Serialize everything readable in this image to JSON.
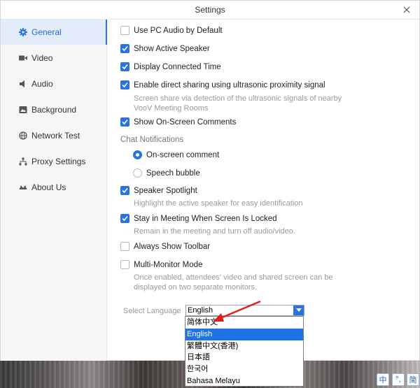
{
  "window": {
    "title": "Settings"
  },
  "sidebar": {
    "items": [
      {
        "label": "General",
        "icon": "gear-icon",
        "active": true
      },
      {
        "label": "Video",
        "icon": "video-camera-icon"
      },
      {
        "label": "Audio",
        "icon": "speaker-icon"
      },
      {
        "label": "Background",
        "icon": "image-icon"
      },
      {
        "label": "Network Test",
        "icon": "globe-icon"
      },
      {
        "label": "Proxy Settings",
        "icon": "network-icon"
      },
      {
        "label": "About Us",
        "icon": "infinity-icon"
      }
    ]
  },
  "general": {
    "use_pc_audio": {
      "label": "Use PC Audio by Default",
      "checked": false
    },
    "show_active_speaker": {
      "label": "Show Active Speaker",
      "checked": true
    },
    "display_connected_time": {
      "label": "Display Connected Time",
      "checked": true
    },
    "direct_sharing": {
      "label": "Enable direct sharing using ultrasonic proximity signal",
      "checked": true,
      "desc_line1": "Screen share via detection of the ultrasonic signals of nearby",
      "desc_line2": "VooV Meeting Rooms"
    },
    "on_screen_comments": {
      "label": "Show On-Screen Comments",
      "checked": true
    },
    "chat_notifications": {
      "label": "Chat Notifications",
      "options": [
        {
          "label": "On-screen comment",
          "selected": true
        },
        {
          "label": "Speech bubble",
          "selected": false
        }
      ]
    },
    "speaker_spotlight": {
      "label": "Speaker Spotlight",
      "checked": true,
      "desc": "Highlight the active speaker for easy identification"
    },
    "stay_in_meeting": {
      "label": "Stay in Meeting When Screen Is Locked",
      "checked": true,
      "desc": "Remain in the meeting and turn off audio/video."
    },
    "always_show_toolbar": {
      "label": "Always Show Toolbar",
      "checked": false
    },
    "multi_monitor": {
      "label": "Multi-Monitor Mode",
      "checked": false,
      "desc_line1": "Once enabled, attendees' video and shared screen can be",
      "desc_line2": "displayed on two separate monitors."
    },
    "language": {
      "label": "Select Language",
      "value": "English",
      "options": [
        "简体中文",
        "English",
        "繁體中文(香港)",
        "日本語",
        "한국어",
        "Bahasa Melayu"
      ],
      "highlighted": "English"
    }
  },
  "taskbar": {
    "ime": [
      "中",
      "°,",
      "简"
    ]
  },
  "colors": {
    "accent": "#2a72e0",
    "annotation_arrow": "#e02020"
  }
}
